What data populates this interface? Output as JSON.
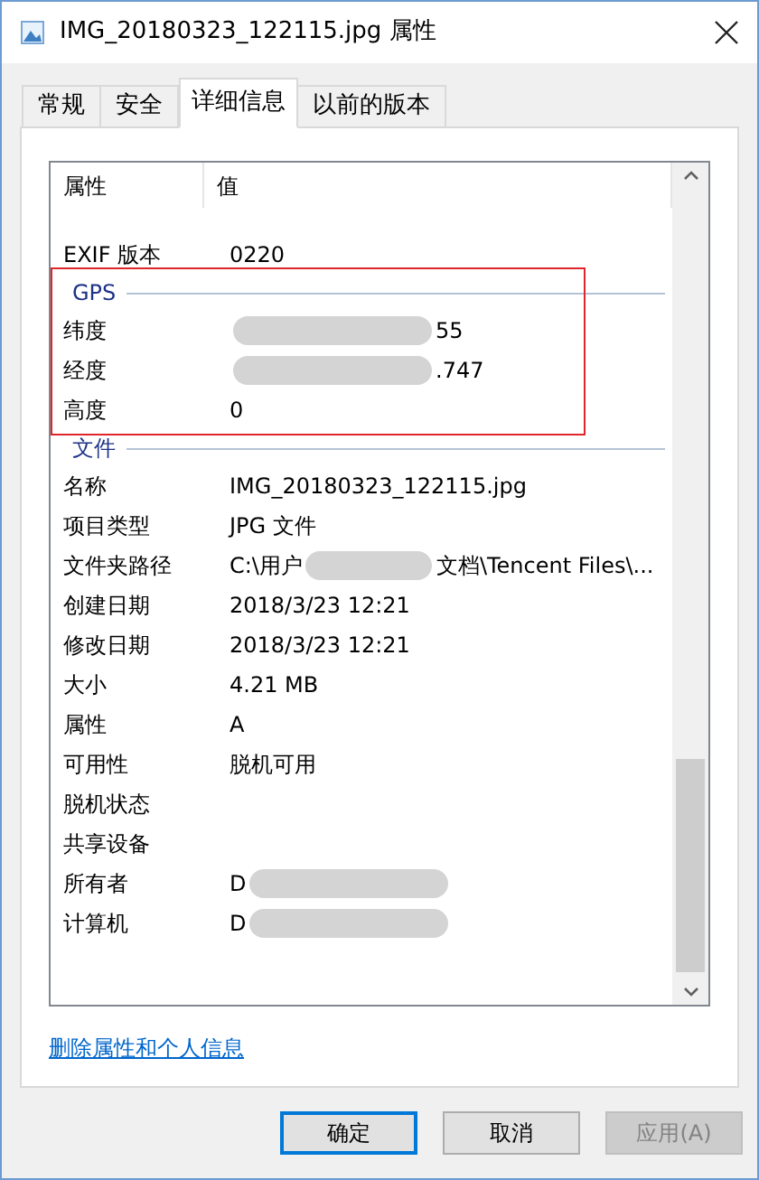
{
  "window": {
    "title": "IMG_20180323_122115.jpg 属性"
  },
  "tabs": [
    {
      "label": "常规",
      "selected": false
    },
    {
      "label": "安全",
      "selected": false
    },
    {
      "label": "详细信息",
      "selected": true
    },
    {
      "label": "以前的版本",
      "selected": false
    }
  ],
  "table": {
    "columns": [
      "属性",
      "值"
    ],
    "groups": [
      {
        "rows": [
          {
            "name": "EXIF 版本",
            "value": [
              {
                "kind": "text",
                "text": "0220"
              }
            ]
          }
        ]
      },
      {
        "title": "GPS",
        "highlighted": true,
        "rows": [
          {
            "name": "纬度",
            "value": [
              {
                "kind": "blur"
              },
              {
                "kind": "text",
                "text": "55"
              }
            ]
          },
          {
            "name": "经度",
            "value": [
              {
                "kind": "blur"
              },
              {
                "kind": "text",
                "text": ".747"
              }
            ]
          },
          {
            "name": "高度",
            "value": [
              {
                "kind": "text",
                "text": "0"
              }
            ]
          }
        ]
      },
      {
        "title": "文件",
        "rows": [
          {
            "name": "名称",
            "value": [
              {
                "kind": "text",
                "text": "IMG_20180323_122115.jpg"
              }
            ]
          },
          {
            "name": "项目类型",
            "value": [
              {
                "kind": "text",
                "text": "JPG 文件"
              }
            ]
          },
          {
            "name": "文件夹路径",
            "value": [
              {
                "kind": "text",
                "text": "C:\\用户"
              },
              {
                "kind": "blur"
              },
              {
                "kind": "text",
                "text": "文档\\Tencent Files\\..."
              }
            ]
          },
          {
            "name": "创建日期",
            "value": [
              {
                "kind": "text",
                "text": "2018/3/23 12:21"
              }
            ]
          },
          {
            "name": "修改日期",
            "value": [
              {
                "kind": "text",
                "text": "2018/3/23 12:21"
              }
            ]
          },
          {
            "name": "大小",
            "value": [
              {
                "kind": "text",
                "text": "4.21 MB"
              }
            ]
          },
          {
            "name": "属性",
            "value": [
              {
                "kind": "text",
                "text": "A"
              }
            ]
          },
          {
            "name": "可用性",
            "value": [
              {
                "kind": "text",
                "text": "脱机可用"
              }
            ]
          },
          {
            "name": "脱机状态"
          },
          {
            "name": "共享设备"
          },
          {
            "name": "所有者",
            "value": [
              {
                "kind": "text",
                "text": "D"
              },
              {
                "kind": "blur"
              }
            ]
          },
          {
            "name": "计算机",
            "value": [
              {
                "kind": "text",
                "text": "D"
              },
              {
                "kind": "blur"
              }
            ]
          }
        ]
      }
    ]
  },
  "link": "删除属性和个人信息",
  "buttons": [
    {
      "label": "确定",
      "default": true,
      "disabled": false
    },
    {
      "label": "取消",
      "default": false,
      "disabled": false
    },
    {
      "label": "应用(A)",
      "default": false,
      "disabled": true
    }
  ]
}
